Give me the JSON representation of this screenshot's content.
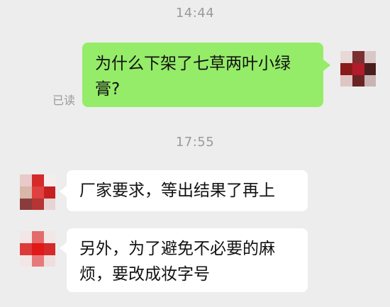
{
  "chat": {
    "messages": [
      {
        "time": "14:44"
      },
      {
        "direction": "outgoing",
        "text": "为什么下架了七草两叶小绿膏?",
        "status": "已读"
      },
      {
        "time": "17:55"
      },
      {
        "direction": "incoming",
        "text": "厂家要求，等出结果了再上"
      },
      {
        "direction": "incoming",
        "text": "另外，为了避免不必要的麻烦，要改成妆字号"
      }
    ]
  },
  "colors": {
    "background": "#ededed",
    "outgoing_bubble": "#95ec69",
    "incoming_bubble": "#ffffff",
    "timestamp_text": "#9a9a9a"
  }
}
